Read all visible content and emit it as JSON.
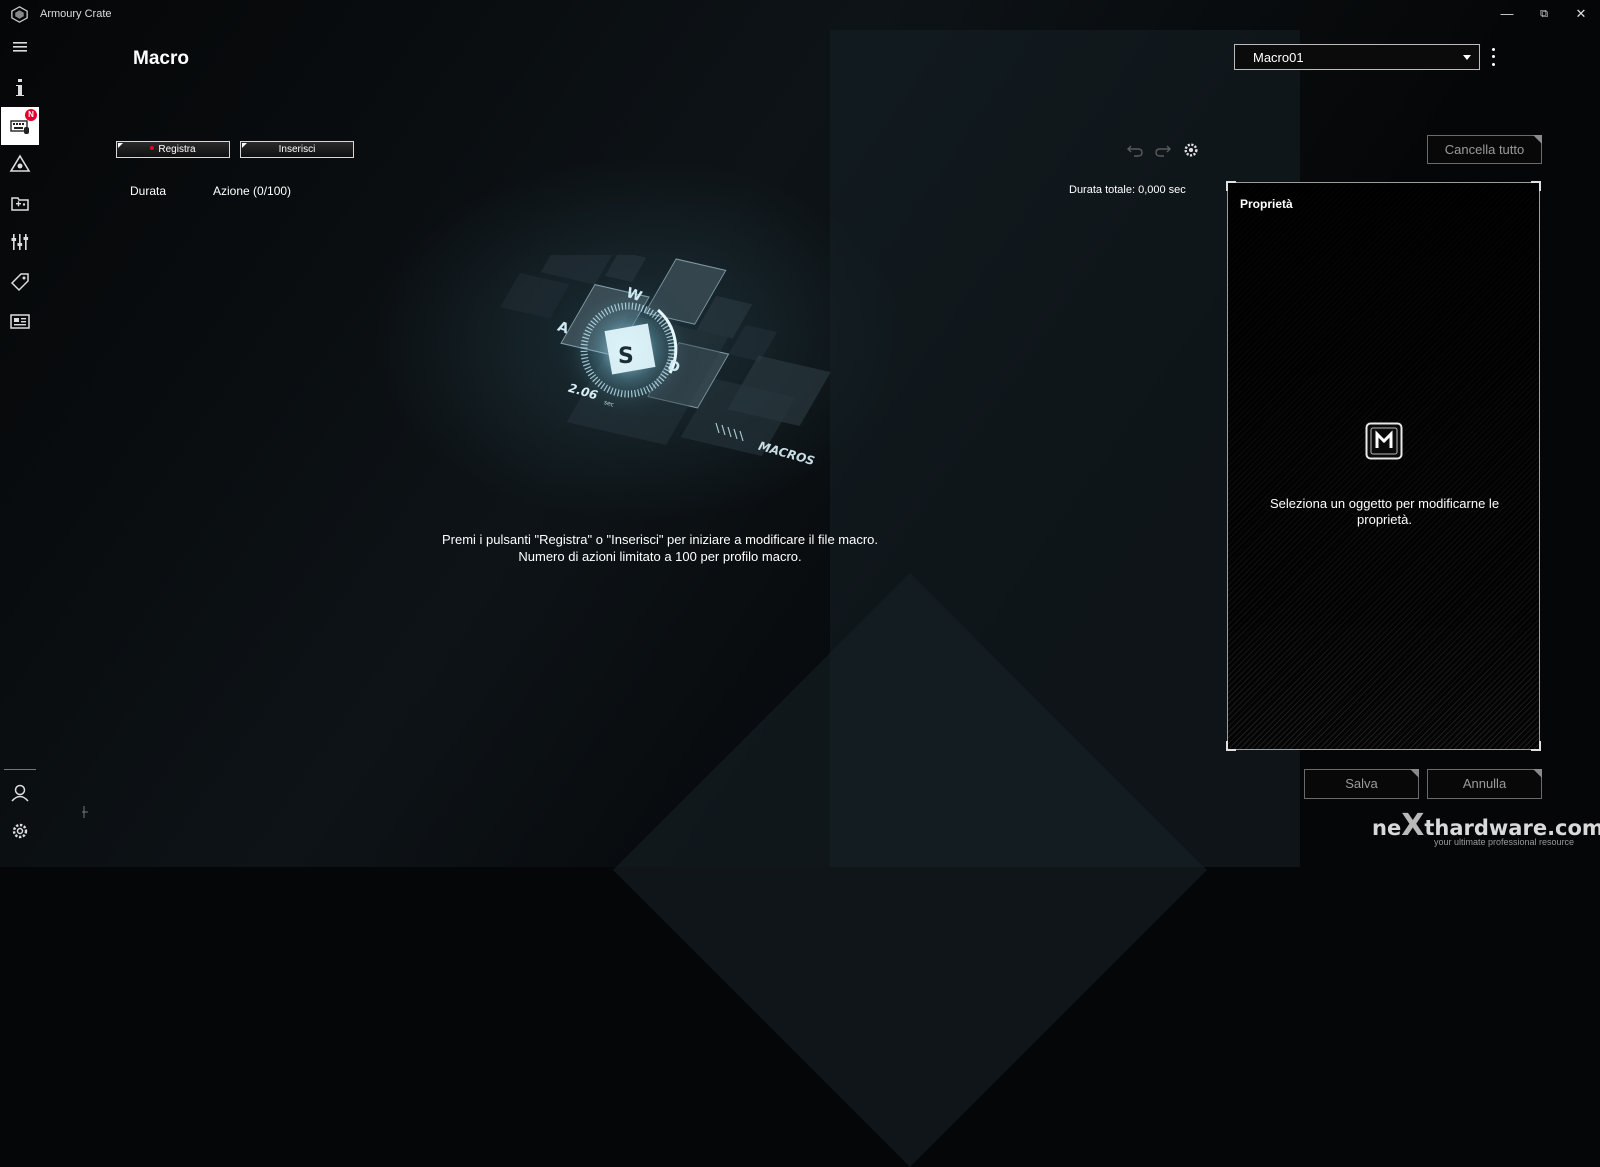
{
  "app": {
    "title": "Armoury Crate"
  },
  "window_controls": {
    "minimize": "—",
    "maximize": "⧉",
    "close": "✕"
  },
  "sidebar": {
    "items": [
      {
        "icon": "hamburger-menu-icon"
      },
      {
        "icon": "info-icon"
      },
      {
        "icon": "keyboard-device-icon",
        "badge": "N",
        "active": true
      },
      {
        "icon": "aura-triangle-icon"
      },
      {
        "icon": "game-library-icon"
      },
      {
        "icon": "settings-sliders-icon"
      },
      {
        "icon": "deals-tag-icon"
      },
      {
        "icon": "news-icon"
      }
    ],
    "bottom": [
      {
        "icon": "user-profile-icon"
      },
      {
        "icon": "gear-icon"
      }
    ]
  },
  "page": {
    "title": "Macro"
  },
  "profile_select": {
    "value": "Macro01"
  },
  "toolbar": {
    "record_label": "Registra",
    "insert_label": "Inserisci",
    "clear_all_label": "Cancella tutto"
  },
  "list": {
    "col_duration": "Durata",
    "col_action": "Azione (0/100)",
    "total_duration": "Durata totale: 0,000 sec"
  },
  "illustration": {
    "keys": [
      "W",
      "A",
      "S",
      "D"
    ],
    "time_text": "2.06",
    "time_unit": "sec",
    "label": "MACROS"
  },
  "empty_state": {
    "line1": "Premi i pulsanti \"Registra\" o \"Inserisci\" per iniziare a modificare il file macro.",
    "line2": "Numero di azioni limitato a 100 per profilo macro."
  },
  "properties": {
    "title": "Proprietà",
    "message": "Seleziona un oggetto per modificarne le proprietà."
  },
  "footer": {
    "save_label": "Salva",
    "cancel_label": "Annulla"
  },
  "watermark": {
    "brand_left": "ne",
    "brand_x": "X",
    "brand_right": "thardware.com",
    "tagline": "your ultimate professional resource"
  },
  "colors": {
    "accent_red": "#e4002b",
    "background": "#050607",
    "panel_border": "#9d9d9d"
  }
}
